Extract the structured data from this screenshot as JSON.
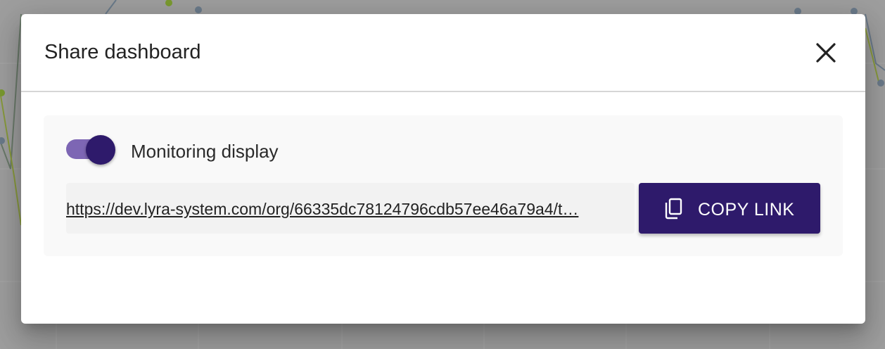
{
  "dialog": {
    "title": "Share dashboard",
    "close_icon": "close-icon"
  },
  "share": {
    "toggle_label": "Monitoring display",
    "toggle_on": true,
    "link_url": "https://dev.lyra-system.com/org/66335dc78124796cdb57ee46a79a4/t…",
    "copy_button_label": "COPY LINK",
    "copy_icon": "copy-icon"
  },
  "colors": {
    "accent": "#2e1a6b",
    "toggle_track": "#7d66b4",
    "background_overlay": "#9e9e9e"
  }
}
